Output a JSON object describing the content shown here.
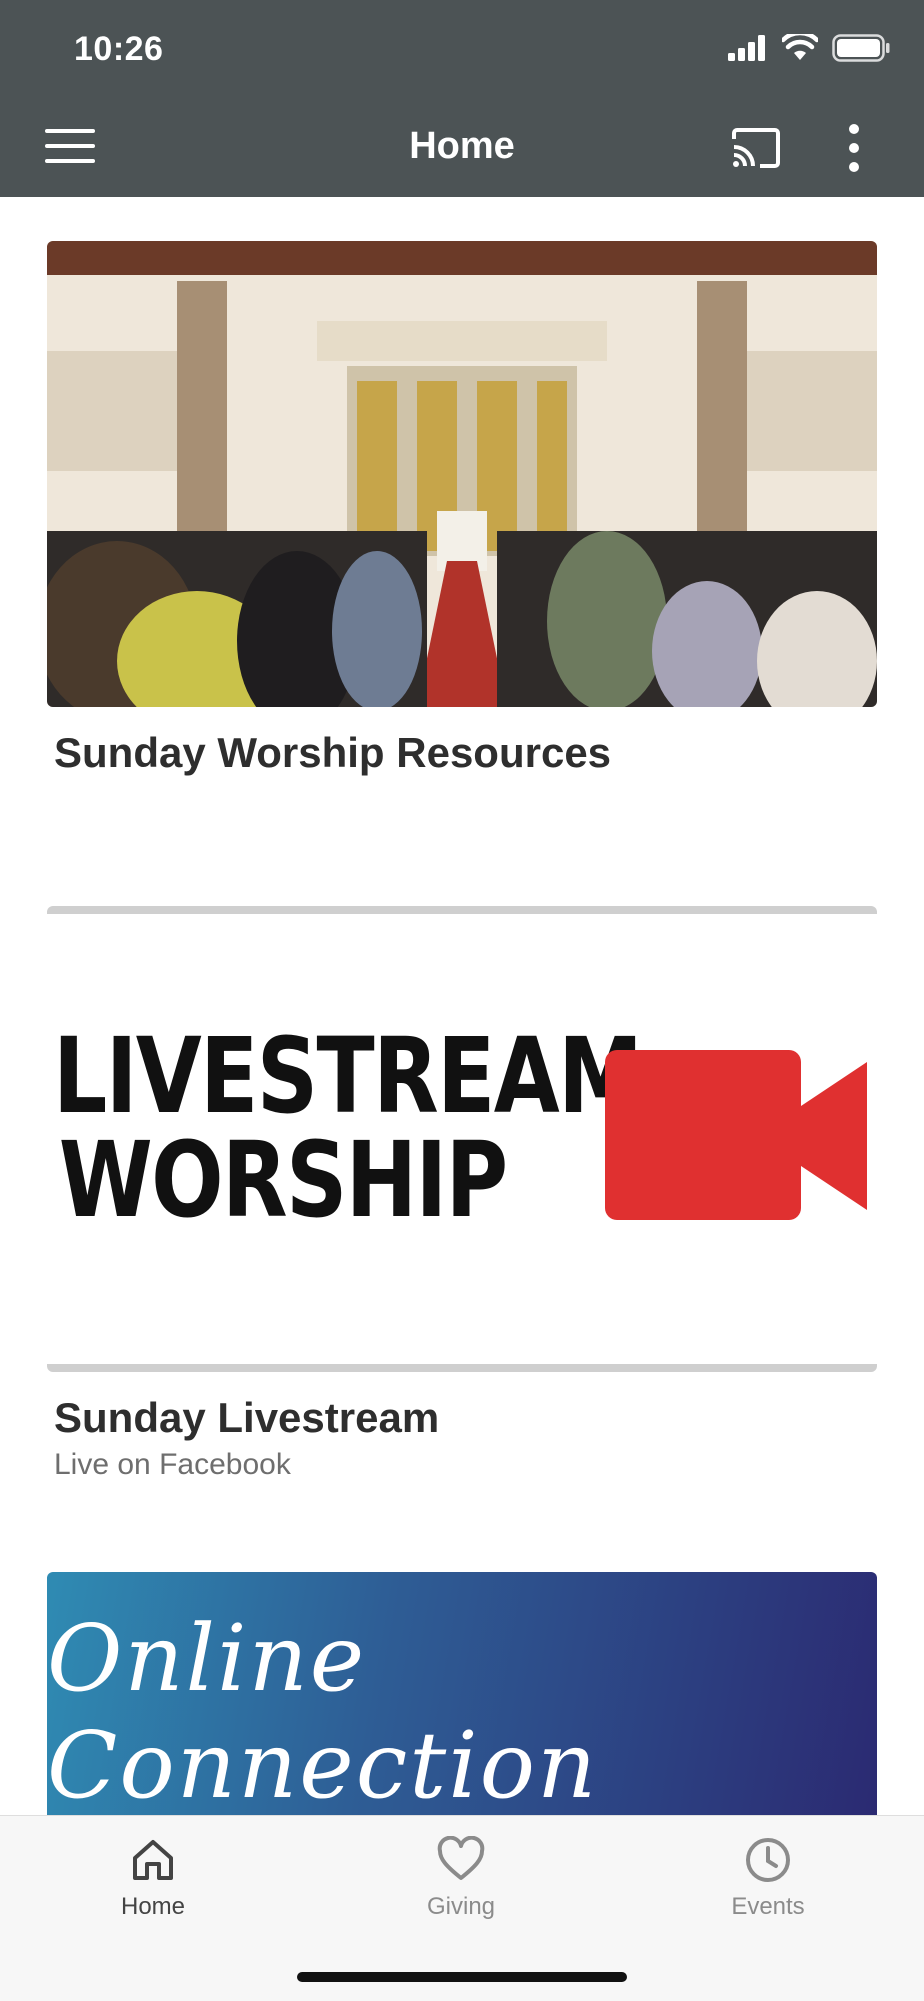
{
  "status_bar": {
    "time": "10:26"
  },
  "nav": {
    "title": "Home"
  },
  "cards": [
    {
      "title": "Sunday Worship Resources",
      "image": "church-sanctuary-photo"
    },
    {
      "title": "Sunday Livestream",
      "subtitle": "Live on Facebook",
      "image_text_line1": "LIVESTREAM",
      "image_text_line2": "WORSHIP",
      "accent": "#e03030"
    },
    {
      "image_text": "Online Connection"
    }
  ],
  "tabs": [
    {
      "label": "Home",
      "icon": "home-icon",
      "active": true
    },
    {
      "label": "Giving",
      "icon": "heart-icon",
      "active": false
    },
    {
      "label": "Events",
      "icon": "clock-icon",
      "active": false
    }
  ],
  "colors": {
    "header": "#4c5355",
    "active_tab": "#444444",
    "inactive_tab": "#8b8b8b"
  }
}
